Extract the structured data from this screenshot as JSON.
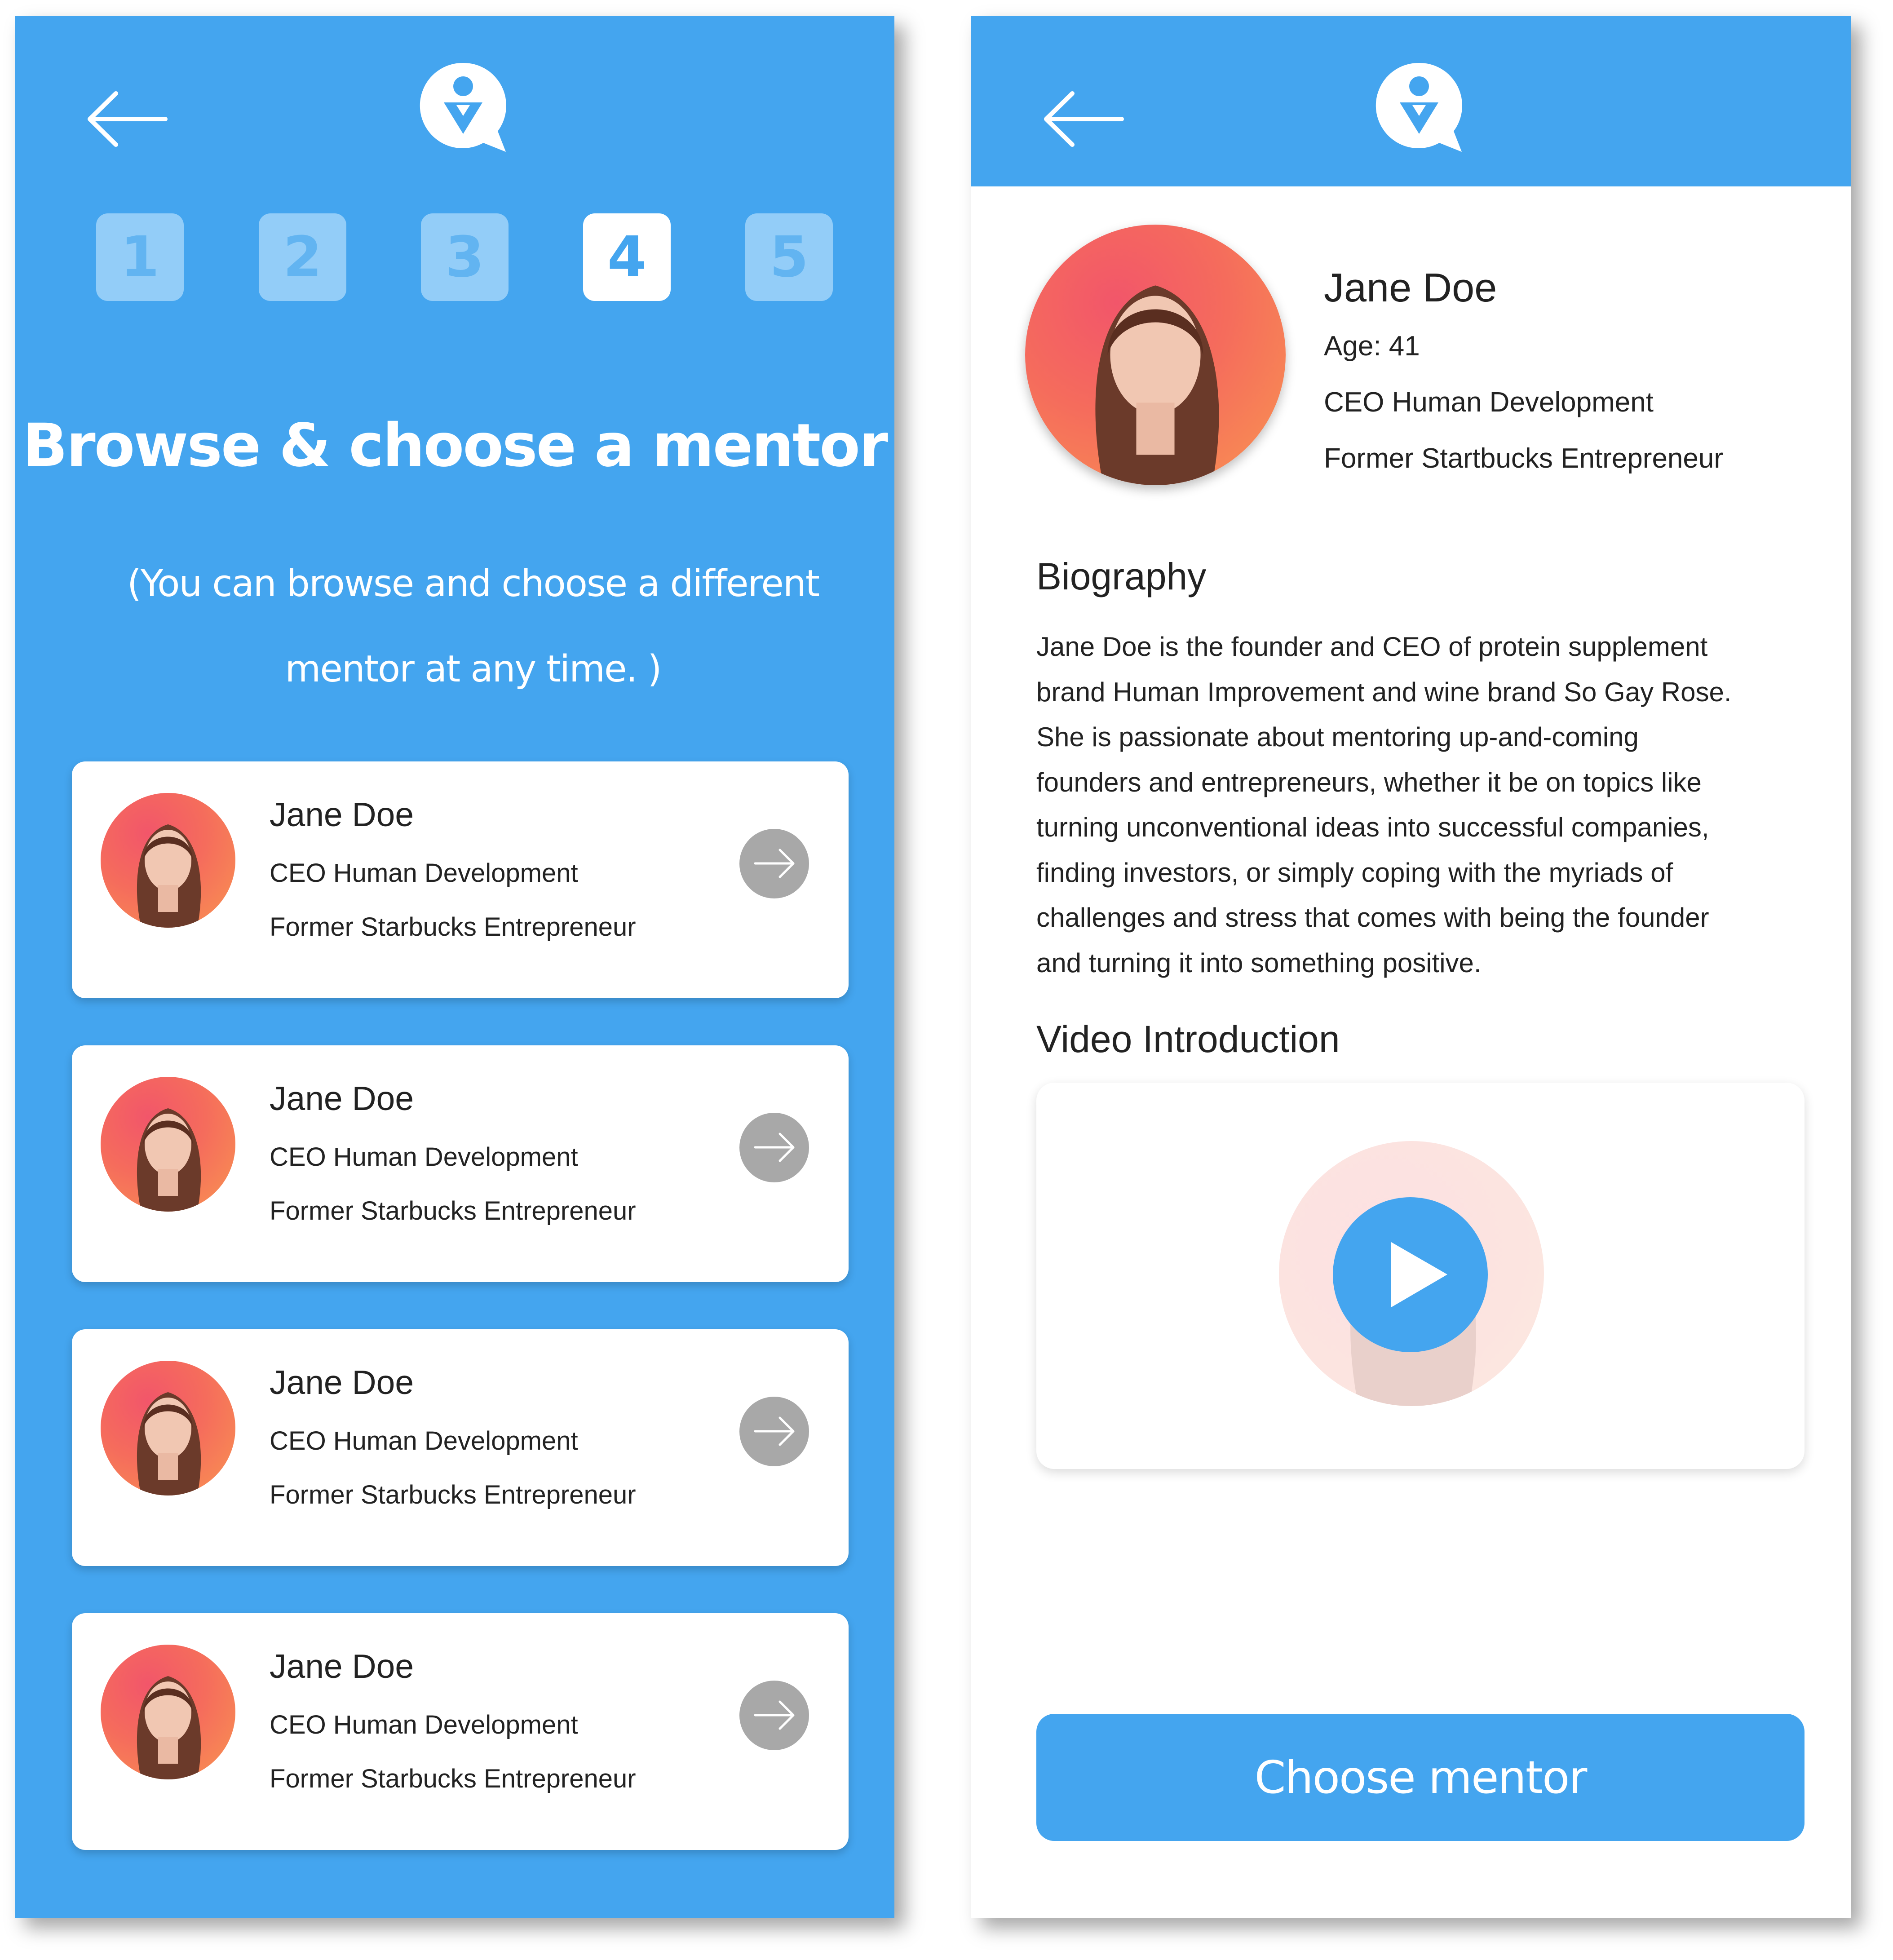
{
  "list_screen": {
    "steps": [
      "1",
      "2",
      "3",
      "4",
      "5"
    ],
    "active_step": "4",
    "title": "Browse & choose a mentor",
    "subtitle_line1": "(You can browse and choose a different",
    "subtitle_line2": "mentor at any time. )",
    "mentors": [
      {
        "name": "Jane Doe",
        "role": "CEO Human Development",
        "former": "Former Starbucks Entrepreneur"
      },
      {
        "name": "Jane Doe",
        "role": "CEO Human Development",
        "former": "Former Starbucks Entrepreneur"
      },
      {
        "name": "Jane Doe",
        "role": "CEO Human Development",
        "former": "Former Starbucks Entrepreneur"
      },
      {
        "name": "Jane Doe",
        "role": "CEO Human Development",
        "former": "Former Starbucks Entrepreneur"
      }
    ]
  },
  "detail_screen": {
    "name": "Jane Doe",
    "age": "Age: 41",
    "role": "CEO Human Development",
    "former": "Former Startbucks Entrepreneur",
    "biography_heading": "Biography",
    "biography_lines": [
      "Jane Doe is the founder and CEO of protein supplement",
      "brand Human Improvement and wine brand So Gay Rose.",
      "She is passionate about mentoring up-and-coming",
      "founders and entrepreneurs, whether it be on topics like",
      "turning unconventional ideas into successful companies,",
      "finding investors, or simply coping with the myriads of",
      "challenges and stress that comes with being the founder",
      "and turning it into something positive."
    ],
    "video_heading": "Video Introduction",
    "choose_button": "Choose mentor"
  },
  "icons": {
    "back": "arrow-left-icon",
    "logo": "mentor-logo-icon",
    "go": "arrow-right-icon",
    "play": "play-icon"
  },
  "colors": {
    "primary": "#44a5ef",
    "step_inactive": "#93cdf8",
    "go_button": "#a8a8a8",
    "avatar_gradient_start": "#f2566a",
    "avatar_gradient_end": "#f99551"
  }
}
